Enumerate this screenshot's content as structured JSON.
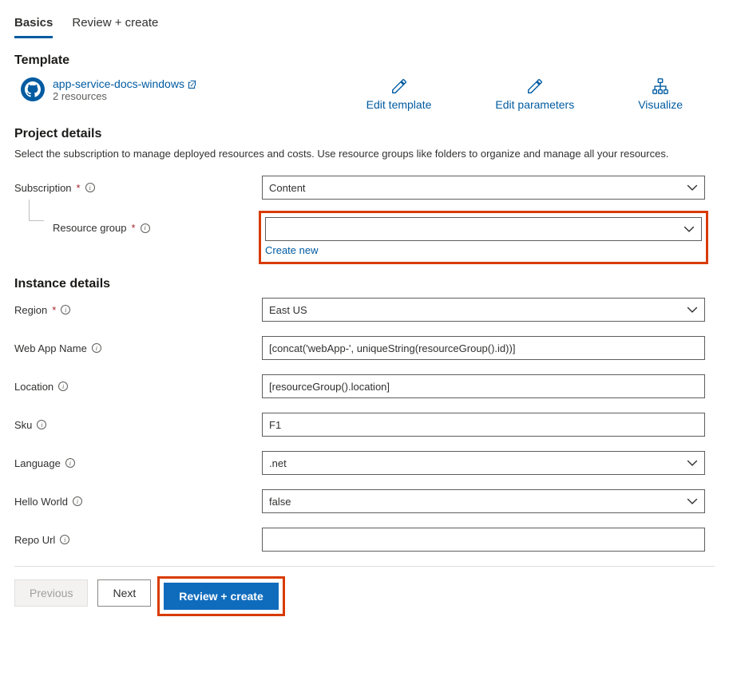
{
  "tabs": {
    "basics": "Basics",
    "review": "Review + create"
  },
  "template": {
    "header": "Template",
    "link_text": "app-service-docs-windows",
    "resource_count": "2 resources",
    "actions": {
      "edit_template": "Edit template",
      "edit_parameters": "Edit parameters",
      "visualize": "Visualize"
    }
  },
  "project_details": {
    "header": "Project details",
    "description": "Select the subscription to manage deployed resources and costs. Use resource groups like folders to organize and manage all your resources.",
    "subscription_label": "Subscription",
    "subscription_value": "Content",
    "resource_group_label": "Resource group",
    "resource_group_value": "",
    "create_new": "Create new"
  },
  "instance_details": {
    "header": "Instance details",
    "region_label": "Region",
    "region_value": "East US",
    "webapp_label": "Web App Name",
    "webapp_value": "[concat('webApp-', uniqueString(resourceGroup().id))]",
    "location_label": "Location",
    "location_value": "[resourceGroup().location]",
    "sku_label": "Sku",
    "sku_value": "F1",
    "language_label": "Language",
    "language_value": ".net",
    "hello_label": "Hello World",
    "hello_value": "false",
    "repo_label": "Repo Url",
    "repo_value": ""
  },
  "footer": {
    "previous": "Previous",
    "next": "Next",
    "review_create": "Review + create"
  }
}
